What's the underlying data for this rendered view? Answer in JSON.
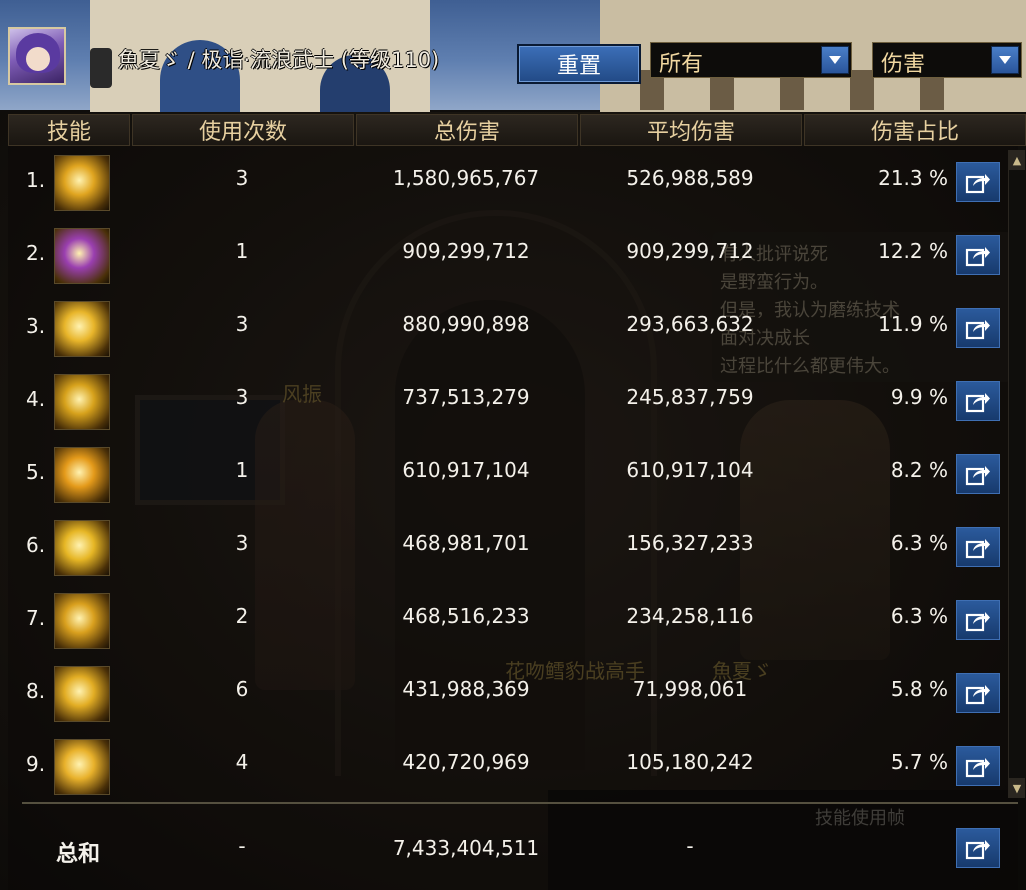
{
  "header": {
    "character": "魚夏ゞ / 极诣·流浪武士 (等级110)",
    "reset_label": "重置",
    "filter_value": "所有",
    "metric_value": "伤害"
  },
  "columns": {
    "skill": "技能",
    "uses": "使用次数",
    "total": "总伤害",
    "avg": "平均伤害",
    "pct": "伤害占比"
  },
  "rows": [
    {
      "rank": "1.",
      "uses": "3",
      "total": "1,580,965,767",
      "avg": "526,988,589",
      "pct": "21.3 %",
      "icon": "golden-burst-skill-icon",
      "icon_color": "#e0a520"
    },
    {
      "rank": "2.",
      "uses": "1",
      "total": "909,299,712",
      "avg": "909,299,712",
      "pct": "12.2 %",
      "icon": "purple-character-skill-icon",
      "icon_color": "#9a3fb0"
    },
    {
      "rank": "3.",
      "uses": "3",
      "total": "880,990,898",
      "avg": "293,663,632",
      "pct": "11.9 %",
      "icon": "golden-swirl-skill-icon",
      "icon_color": "#e8b52a"
    },
    {
      "rank": "4.",
      "uses": "3",
      "total": "737,513,279",
      "avg": "245,837,759",
      "pct": "9.9 %",
      "icon": "crossed-slash-skill-icon",
      "icon_color": "#d7a21c"
    },
    {
      "rank": "5.",
      "uses": "1",
      "total": "610,917,104",
      "avg": "610,917,104",
      "pct": "8.2 %",
      "icon": "golden-vortex-skill-icon",
      "icon_color": "#e49a1a"
    },
    {
      "rank": "6.",
      "uses": "3",
      "total": "468,981,701",
      "avg": "156,327,233",
      "pct": "6.3 %",
      "icon": "lightning-slash-skill-icon",
      "icon_color": "#e6b625"
    },
    {
      "rank": "7.",
      "uses": "2",
      "total": "468,516,233",
      "avg": "234,258,116",
      "pct": "6.3 %",
      "icon": "palm-skill-icon",
      "icon_color": "#d9a01e"
    },
    {
      "rank": "8.",
      "uses": "6",
      "total": "431,988,369",
      "avg": "71,998,061",
      "pct": "5.8 %",
      "icon": "multi-strike-skill-icon",
      "icon_color": "#e2ad24"
    },
    {
      "rank": "9.",
      "uses": "4",
      "total": "420,720,969",
      "avg": "105,180,242",
      "pct": "5.7 %",
      "icon": "explosion-skill-icon",
      "icon_color": "#e8b12b"
    }
  ],
  "summary": {
    "label": "总和",
    "uses": "-",
    "total": "7,433,404,511",
    "avg": "-"
  },
  "background": {
    "bubble_text": [
      "有人批评说死",
      "是野蛮行为。",
      "但是，我认为磨练技术",
      "面对决成长",
      "过程比什么都更伟大。"
    ],
    "npc_label": "风振",
    "player_label": "花吻鳕豹战高手",
    "player2_label": "魚夏ゞ",
    "footer_text": "技能使用帧"
  },
  "colors": {
    "button_blue": "#2b5a9c",
    "header_text": "#e7d0a0",
    "value_text": "#f4f1ea"
  }
}
